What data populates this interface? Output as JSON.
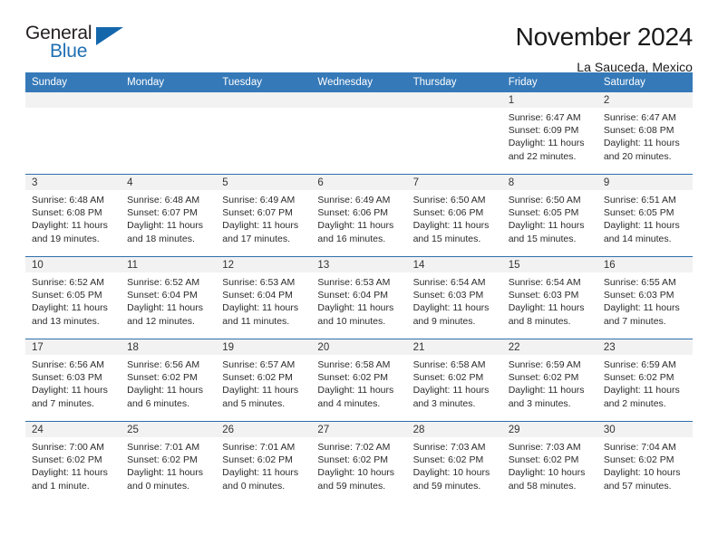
{
  "brand": {
    "name_part1": "General",
    "name_part2": "Blue",
    "accent_color": "#1567ac"
  },
  "header": {
    "title": "November 2024",
    "subtitle": "La Sauceda, Mexico"
  },
  "calendar": {
    "header_bg": "#3579b8",
    "weekdays": [
      "Sunday",
      "Monday",
      "Tuesday",
      "Wednesday",
      "Thursday",
      "Friday",
      "Saturday"
    ],
    "weeks": [
      [
        {
          "day": "",
          "lines": []
        },
        {
          "day": "",
          "lines": []
        },
        {
          "day": "",
          "lines": []
        },
        {
          "day": "",
          "lines": []
        },
        {
          "day": "",
          "lines": []
        },
        {
          "day": "1",
          "lines": [
            "Sunrise: 6:47 AM",
            "Sunset: 6:09 PM",
            "Daylight: 11 hours",
            "and 22 minutes."
          ]
        },
        {
          "day": "2",
          "lines": [
            "Sunrise: 6:47 AM",
            "Sunset: 6:08 PM",
            "Daylight: 11 hours",
            "and 20 minutes."
          ]
        }
      ],
      [
        {
          "day": "3",
          "lines": [
            "Sunrise: 6:48 AM",
            "Sunset: 6:08 PM",
            "Daylight: 11 hours",
            "and 19 minutes."
          ]
        },
        {
          "day": "4",
          "lines": [
            "Sunrise: 6:48 AM",
            "Sunset: 6:07 PM",
            "Daylight: 11 hours",
            "and 18 minutes."
          ]
        },
        {
          "day": "5",
          "lines": [
            "Sunrise: 6:49 AM",
            "Sunset: 6:07 PM",
            "Daylight: 11 hours",
            "and 17 minutes."
          ]
        },
        {
          "day": "6",
          "lines": [
            "Sunrise: 6:49 AM",
            "Sunset: 6:06 PM",
            "Daylight: 11 hours",
            "and 16 minutes."
          ]
        },
        {
          "day": "7",
          "lines": [
            "Sunrise: 6:50 AM",
            "Sunset: 6:06 PM",
            "Daylight: 11 hours",
            "and 15 minutes."
          ]
        },
        {
          "day": "8",
          "lines": [
            "Sunrise: 6:50 AM",
            "Sunset: 6:05 PM",
            "Daylight: 11 hours",
            "and 15 minutes."
          ]
        },
        {
          "day": "9",
          "lines": [
            "Sunrise: 6:51 AM",
            "Sunset: 6:05 PM",
            "Daylight: 11 hours",
            "and 14 minutes."
          ]
        }
      ],
      [
        {
          "day": "10",
          "lines": [
            "Sunrise: 6:52 AM",
            "Sunset: 6:05 PM",
            "Daylight: 11 hours",
            "and 13 minutes."
          ]
        },
        {
          "day": "11",
          "lines": [
            "Sunrise: 6:52 AM",
            "Sunset: 6:04 PM",
            "Daylight: 11 hours",
            "and 12 minutes."
          ]
        },
        {
          "day": "12",
          "lines": [
            "Sunrise: 6:53 AM",
            "Sunset: 6:04 PM",
            "Daylight: 11 hours",
            "and 11 minutes."
          ]
        },
        {
          "day": "13",
          "lines": [
            "Sunrise: 6:53 AM",
            "Sunset: 6:04 PM",
            "Daylight: 11 hours",
            "and 10 minutes."
          ]
        },
        {
          "day": "14",
          "lines": [
            "Sunrise: 6:54 AM",
            "Sunset: 6:03 PM",
            "Daylight: 11 hours",
            "and 9 minutes."
          ]
        },
        {
          "day": "15",
          "lines": [
            "Sunrise: 6:54 AM",
            "Sunset: 6:03 PM",
            "Daylight: 11 hours",
            "and 8 minutes."
          ]
        },
        {
          "day": "16",
          "lines": [
            "Sunrise: 6:55 AM",
            "Sunset: 6:03 PM",
            "Daylight: 11 hours",
            "and 7 minutes."
          ]
        }
      ],
      [
        {
          "day": "17",
          "lines": [
            "Sunrise: 6:56 AM",
            "Sunset: 6:03 PM",
            "Daylight: 11 hours",
            "and 7 minutes."
          ]
        },
        {
          "day": "18",
          "lines": [
            "Sunrise: 6:56 AM",
            "Sunset: 6:02 PM",
            "Daylight: 11 hours",
            "and 6 minutes."
          ]
        },
        {
          "day": "19",
          "lines": [
            "Sunrise: 6:57 AM",
            "Sunset: 6:02 PM",
            "Daylight: 11 hours",
            "and 5 minutes."
          ]
        },
        {
          "day": "20",
          "lines": [
            "Sunrise: 6:58 AM",
            "Sunset: 6:02 PM",
            "Daylight: 11 hours",
            "and 4 minutes."
          ]
        },
        {
          "day": "21",
          "lines": [
            "Sunrise: 6:58 AM",
            "Sunset: 6:02 PM",
            "Daylight: 11 hours",
            "and 3 minutes."
          ]
        },
        {
          "day": "22",
          "lines": [
            "Sunrise: 6:59 AM",
            "Sunset: 6:02 PM",
            "Daylight: 11 hours",
            "and 3 minutes."
          ]
        },
        {
          "day": "23",
          "lines": [
            "Sunrise: 6:59 AM",
            "Sunset: 6:02 PM",
            "Daylight: 11 hours",
            "and 2 minutes."
          ]
        }
      ],
      [
        {
          "day": "24",
          "lines": [
            "Sunrise: 7:00 AM",
            "Sunset: 6:02 PM",
            "Daylight: 11 hours",
            "and 1 minute."
          ]
        },
        {
          "day": "25",
          "lines": [
            "Sunrise: 7:01 AM",
            "Sunset: 6:02 PM",
            "Daylight: 11 hours",
            "and 0 minutes."
          ]
        },
        {
          "day": "26",
          "lines": [
            "Sunrise: 7:01 AM",
            "Sunset: 6:02 PM",
            "Daylight: 11 hours",
            "and 0 minutes."
          ]
        },
        {
          "day": "27",
          "lines": [
            "Sunrise: 7:02 AM",
            "Sunset: 6:02 PM",
            "Daylight: 10 hours",
            "and 59 minutes."
          ]
        },
        {
          "day": "28",
          "lines": [
            "Sunrise: 7:03 AM",
            "Sunset: 6:02 PM",
            "Daylight: 10 hours",
            "and 59 minutes."
          ]
        },
        {
          "day": "29",
          "lines": [
            "Sunrise: 7:03 AM",
            "Sunset: 6:02 PM",
            "Daylight: 10 hours",
            "and 58 minutes."
          ]
        },
        {
          "day": "30",
          "lines": [
            "Sunrise: 7:04 AM",
            "Sunset: 6:02 PM",
            "Daylight: 10 hours",
            "and 57 minutes."
          ]
        }
      ]
    ]
  }
}
